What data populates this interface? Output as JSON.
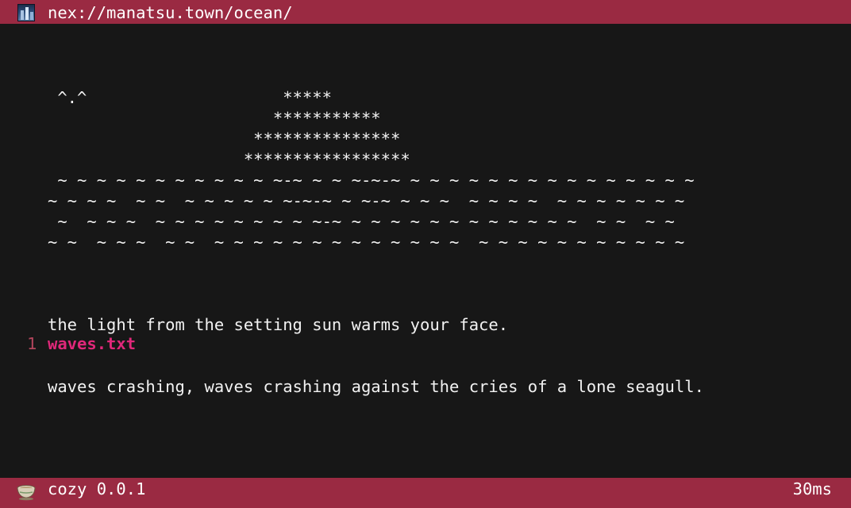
{
  "topbar": {
    "url": "nex://manatsu.town/ocean/",
    "favicon_icon": "site-favicon-icon"
  },
  "content": {
    "ascii_art": [
      " ^.^                    *****",
      "                       ***********",
      "                     ***************",
      "                    *****************",
      " ~ ~ ~ ~ ~ ~ ~ ~ ~ ~ ~ ~-~ ~ ~ ~-~-~ ~ ~ ~ ~ ~ ~ ~ ~ ~ ~ ~ ~ ~ ~ ~",
      "~ ~ ~ ~  ~ ~  ~ ~ ~ ~ ~ ~-~-~ ~ ~-~ ~ ~ ~  ~ ~ ~ ~  ~ ~ ~ ~ ~ ~ ~",
      " ~  ~ ~ ~  ~ ~ ~ ~ ~ ~ ~ ~ ~-~ ~ ~ ~ ~ ~ ~ ~ ~ ~ ~ ~ ~  ~ ~  ~ ~",
      "~ ~  ~ ~ ~  ~ ~  ~ ~ ~ ~ ~ ~ ~ ~ ~ ~ ~ ~ ~  ~ ~ ~ ~ ~ ~ ~ ~ ~ ~ ~"
    ],
    "prose": [
      "the light from the setting sun warms your face.",
      "waves crashing, waves crashing against the cries of a lone seagull."
    ]
  },
  "links": [
    {
      "number": "1",
      "label": "waves.txt"
    }
  ],
  "statusbar": {
    "app_name": "cozy 0.0.1",
    "timing": "30ms",
    "app_icon": "teacup-icon"
  },
  "colors": {
    "bar_background": "#9a2a42",
    "page_background": "#171717",
    "link_color": "#e0287a",
    "link_number_color": "#b3455c"
  }
}
